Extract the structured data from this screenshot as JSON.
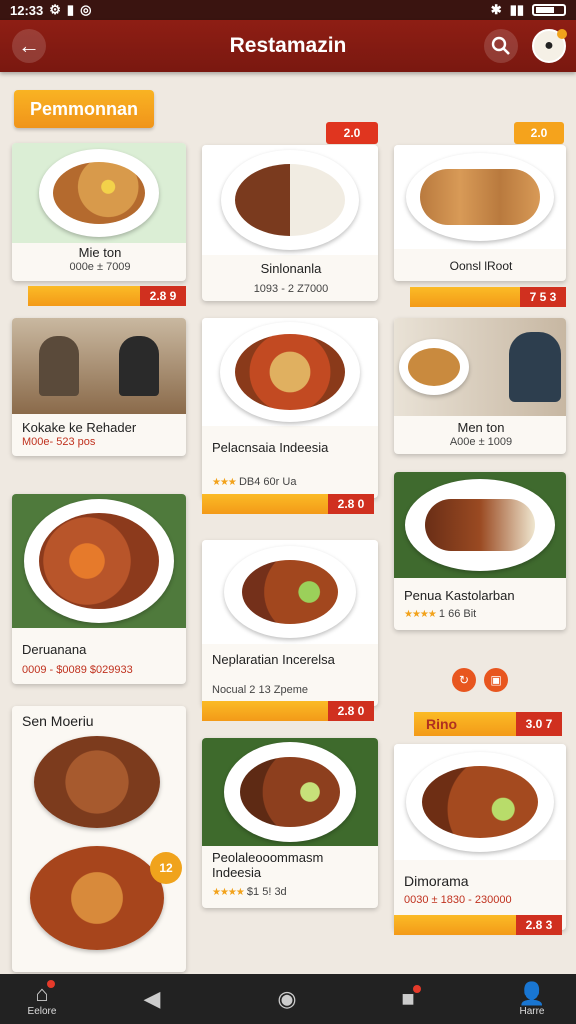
{
  "status_bar": {
    "time": "12:33",
    "icons": [
      "settings-icon",
      "signal-icon",
      "wifi-icon",
      "bluetooth-icon",
      "battery-icon"
    ]
  },
  "app_bar": {
    "title": "Restamazin",
    "back_icon": "arrow-left-icon",
    "search_icon": "search-icon",
    "avatar_icon": "avatar-icon"
  },
  "section": {
    "label": "Pemmonnan"
  },
  "cards": [
    {
      "name": "Mie ton",
      "price": "000e ± 7009"
    },
    {
      "name": "Sinlonanla",
      "price": "1093 - 2 Z7000"
    },
    {
      "name": "Oonsl lRoot"
    },
    {
      "name": "Kokake ke Rehader",
      "price": "M00e- 523 pos"
    },
    {
      "name": "Pelacnsaia Indeesia",
      "price": "DB4 60r Ua"
    },
    {
      "name": "Men ton",
      "price": "A00e ± 1009"
    },
    {
      "name": "Deruanana",
      "price": "0009 - $0089 $029933"
    },
    {
      "name": "Neplaratian Incerelsa",
      "price": "Nocual 2 13 Zpeme"
    },
    {
      "name": "Penua Kastolarban",
      "price": "1 66 Bit"
    },
    {
      "name": "Sen Moeriu"
    },
    {
      "name": "Peolaleooommasm Indeesia",
      "price": "$1 5! 3d"
    },
    {
      "name": "Dimorama",
      "price": "0030 ± 1830 - 230000"
    }
  ],
  "price_tags": [
    "2.0",
    "2.0",
    "2.8 9",
    "7 5 3",
    "2.8 0",
    "2.8 0",
    "3.0 7",
    "2.8 3"
  ],
  "badges": {
    "rino": "Rino",
    "bowl_number": "12"
  },
  "bottom_nav": [
    {
      "label": "Eelore",
      "icon": "home-icon"
    },
    {
      "label": "",
      "icon": "back-triangle-icon"
    },
    {
      "label": "",
      "icon": "circle-home-icon"
    },
    {
      "label": "",
      "icon": "square-recents-icon"
    },
    {
      "label": "Harre",
      "icon": "person-icon"
    }
  ],
  "colors": {
    "primary": "#8e1e14",
    "accent": "#f9b323",
    "price_red": "#d0301f",
    "background": "#efe9e1"
  }
}
